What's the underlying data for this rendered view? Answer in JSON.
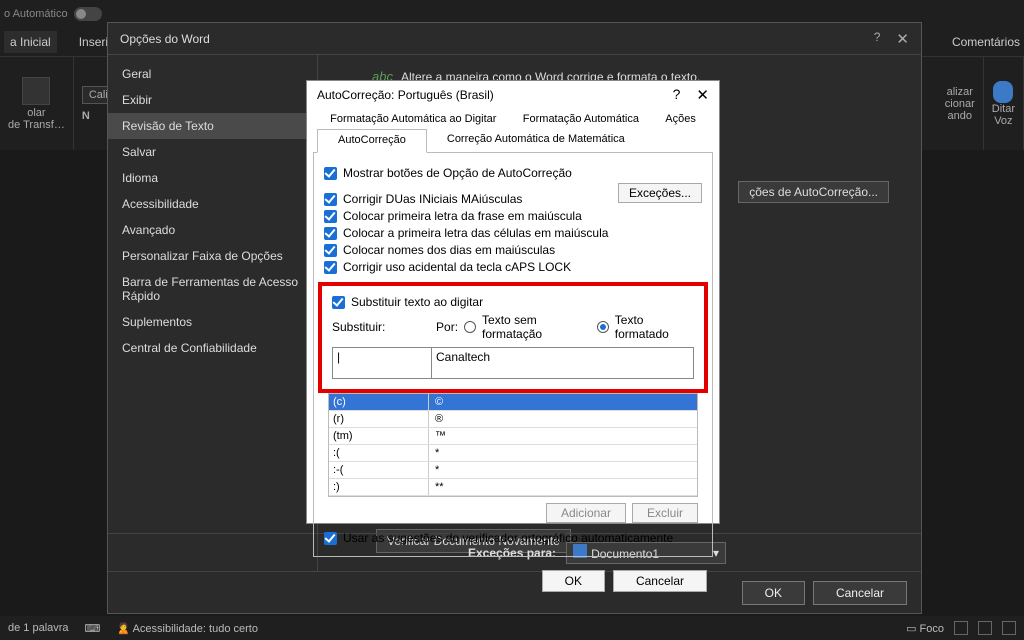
{
  "title_bg": "o Automático",
  "ribbon": {
    "home": "a Inicial",
    "insert": "Inserir",
    "comments": "Comentários",
    "analyze": "alizar",
    "select": "cionar",
    "share": "ando",
    "edit": "de Transf…",
    "voice": "Voz",
    "dictate": "Ditar",
    "font_name": "Calibr",
    "bold": "N",
    "paste": "olar"
  },
  "status": {
    "words": "de 1 palavra",
    "lang_icon": "⌨",
    "access": "Acessibilidade: tudo certo",
    "focus": "Foco"
  },
  "options": {
    "title": "Opções do Word",
    "side": [
      "Geral",
      "Exibir",
      "Revisão de Texto",
      "Salvar",
      "Idioma",
      "Acessibilidade",
      "Avançado",
      "Personalizar Faixa de Opções",
      "Barra de Ferramentas de Acesso Rápido",
      "Suplementos",
      "Central de Confiabilidade"
    ],
    "heading_abc": "abc",
    "heading": "Altere a maneira como o Word corrige e formata o texto.",
    "ac_options_btn": "ções de AutoCorreção...",
    "verify_btn": "Verificar Documento Novamente",
    "exc_label": "Exceções para:",
    "doc_name": "Documento1",
    "ok": "OK",
    "cancel": "Cancelar"
  },
  "ac": {
    "title": "AutoCorreção: Português (Brasil)",
    "help": "?",
    "tabs_top": [
      "Formatação Automática ao Digitar",
      "Formatação Automática",
      "Ações"
    ],
    "tabs_bot": {
      "a": "AutoCorreção",
      "b": "Correção Automática de Matemática"
    },
    "chk1": "Mostrar botões de Opção de AutoCorreção",
    "chk2": "Corrigir DUas INiciais MAiúsculas",
    "chk3": "Colocar primeira letra da frase em maiúscula",
    "chk4": "Colocar a primeira letra das células em maiúscula",
    "chk5": "Colocar nomes dos dias em maiúsculas",
    "chk6": "Corrigir uso acidental da tecla cAPS LOCK",
    "excep": "Exceções...",
    "sub_chk": "Substituir texto ao digitar",
    "sub_lbl": "Substituir:",
    "por_lbl": "Por:",
    "rad1": "Texto sem formatação",
    "rad2": "Texto formatado",
    "input_sub": "|",
    "input_por": "Canaltech",
    "rows": [
      {
        "k": "(c)",
        "v": "©"
      },
      {
        "k": "(r)",
        "v": "®"
      },
      {
        "k": "(tm)",
        "v": "™"
      },
      {
        "k": ":(",
        "v": "*"
      },
      {
        "k": ":-(",
        "v": "*"
      },
      {
        "k": ":)",
        "v": "**"
      }
    ],
    "add": "Adicionar",
    "del": "Excluir",
    "spell": "Usar as sugestões do verificador ortográfico automaticamente",
    "ok": "OK",
    "cancel": "Cancelar"
  }
}
